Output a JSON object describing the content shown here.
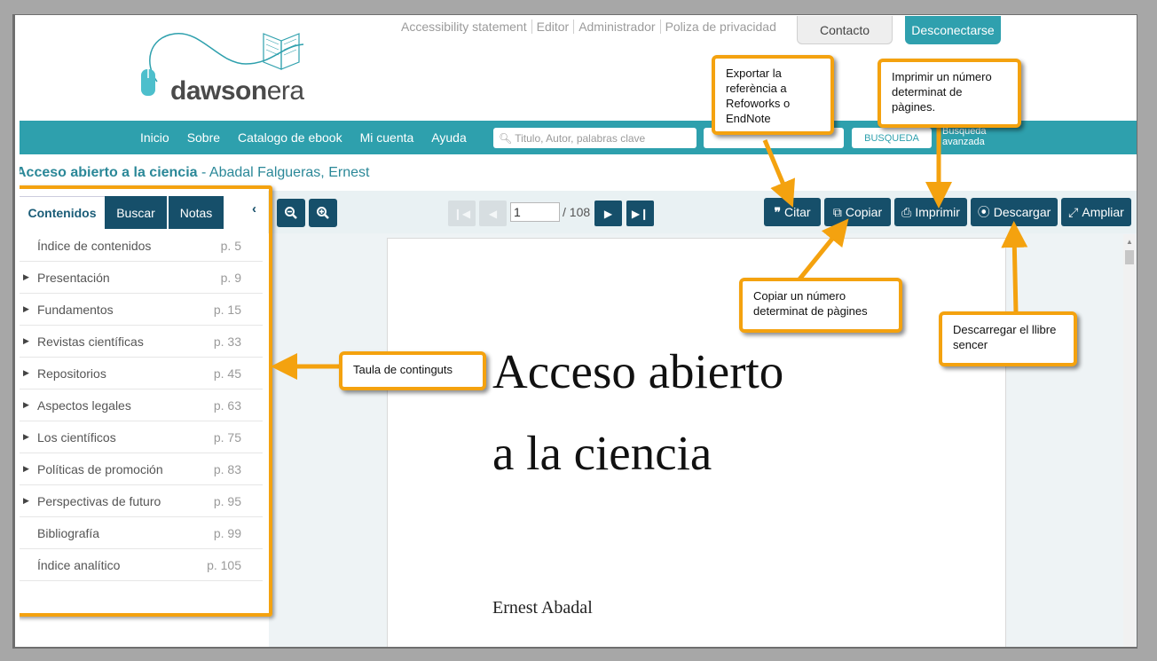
{
  "header": {
    "top_links": [
      "Accessibility statement",
      "Editor",
      "Administrador",
      "Poliza de privacidad"
    ],
    "contact_label": "Contacto",
    "logout_label": "Desconectarse",
    "logo_text_bold": "dawson",
    "logo_text_light": "era"
  },
  "nav": {
    "items": [
      "Inicio",
      "Sobre",
      "Catalogo de ebook",
      "Mi cuenta",
      "Ayuda"
    ],
    "search_placeholder": "Titulo, Autor, palabras clave",
    "search_button": "BUSQUEDA",
    "advanced_line1": "Busqueda",
    "advanced_line2": "avanzada"
  },
  "book": {
    "title": "Acceso abierto a la ciencia",
    "separator": " - ",
    "author": "Abadal Falgueras, Ernest"
  },
  "sidebar": {
    "tabs": [
      "Contenidos",
      "Buscar",
      "Notas"
    ],
    "collapse_icon": "chevron-left",
    "toc": [
      {
        "label": "Índice de contenidos",
        "page": "p. 5",
        "expandable": false
      },
      {
        "label": "Presentación",
        "page": "p. 9",
        "expandable": true
      },
      {
        "label": "Fundamentos",
        "page": "p. 15",
        "expandable": true
      },
      {
        "label": "Revistas científicas",
        "page": "p. 33",
        "expandable": true
      },
      {
        "label": "Repositorios",
        "page": "p. 45",
        "expandable": true
      },
      {
        "label": "Aspectos legales",
        "page": "p. 63",
        "expandable": true
      },
      {
        "label": "Los científicos",
        "page": "p. 75",
        "expandable": true
      },
      {
        "label": "Políticas de promoción",
        "page": "p. 83",
        "expandable": true
      },
      {
        "label": "Perspectivas de futuro",
        "page": "p. 95",
        "expandable": true
      },
      {
        "label": "Bibliografía",
        "page": "p. 99",
        "expandable": false
      },
      {
        "label": "Índice analítico",
        "page": "p. 105",
        "expandable": false
      }
    ]
  },
  "viewer": {
    "current_page": "1",
    "total_pages": "/ 108",
    "tools": {
      "cite": "Citar",
      "copy": "Copiar",
      "print": "Imprimir",
      "download": "Descargar",
      "expand": "Ampliar"
    }
  },
  "document": {
    "title_line1": "Acceso abierto",
    "title_line2": "a la ciencia",
    "author": "Ernest Abadal"
  },
  "callouts": {
    "cite": "Exportar la referència a Refoworks o EndNote",
    "print": "Imprimir un número determinat de pàgines.",
    "copy": "Copiar un número determinat de pàgines",
    "download": "Descarregar el llibre sencer",
    "toc": "Taula de continguts"
  },
  "colors": {
    "accent": "#2ea0ad",
    "dark_button": "#164f6a",
    "highlight": "#f4a20f"
  }
}
